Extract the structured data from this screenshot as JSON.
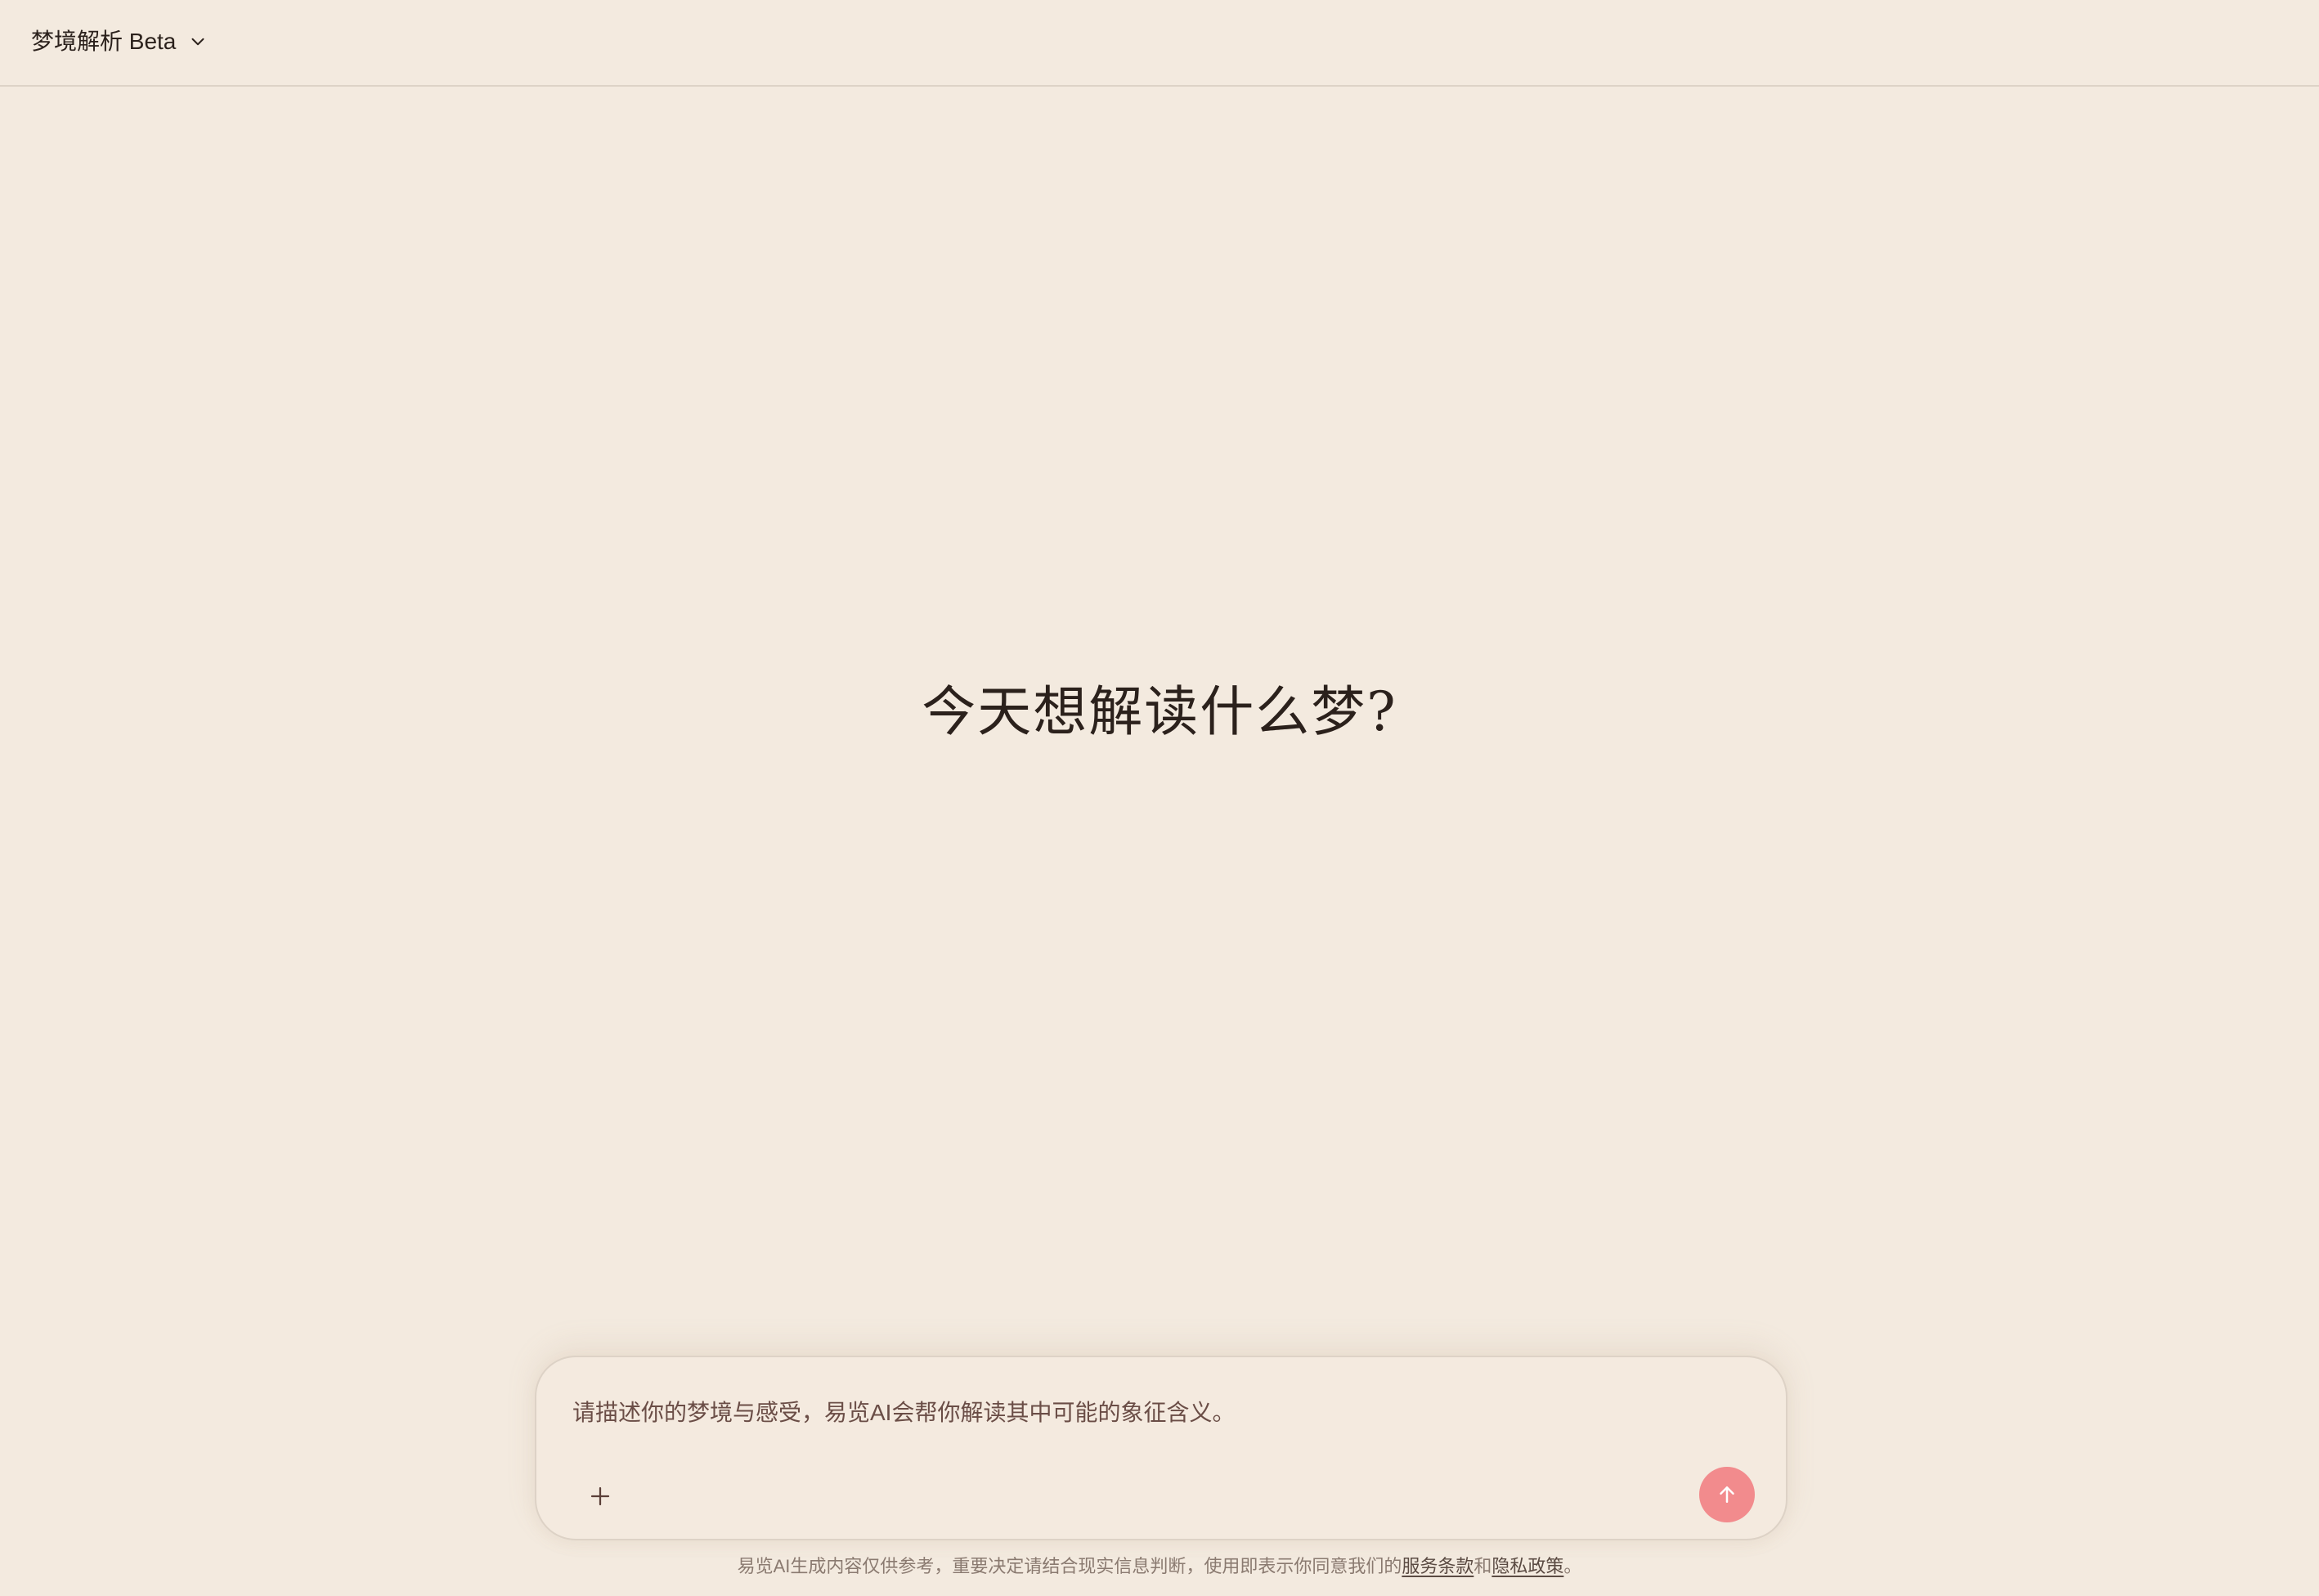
{
  "header": {
    "app_title": "梦境解析 Beta",
    "dropdown_icon": "chevron-down-icon"
  },
  "main": {
    "headline": "今天想解读什么梦?"
  },
  "composer": {
    "placeholder": "请描述你的梦境与感受，易览AI会帮你解读其中可能的象征含义。",
    "value": "",
    "add_icon": "plus-icon",
    "send_icon": "arrow-up-icon",
    "send_color": "#f28b8d"
  },
  "footer": {
    "disclaimer_text": "易览AI生成内容仅供参考，重要决定请结合现实信息判断，使用即表示你同意我们的",
    "terms_link": "服务条款",
    "conjunction": "和",
    "privacy_link": "隐私政策",
    "period": "。"
  },
  "colors": {
    "background": "#f3eadf",
    "text_primary": "#2b211c",
    "accent": "#f28b8d"
  }
}
